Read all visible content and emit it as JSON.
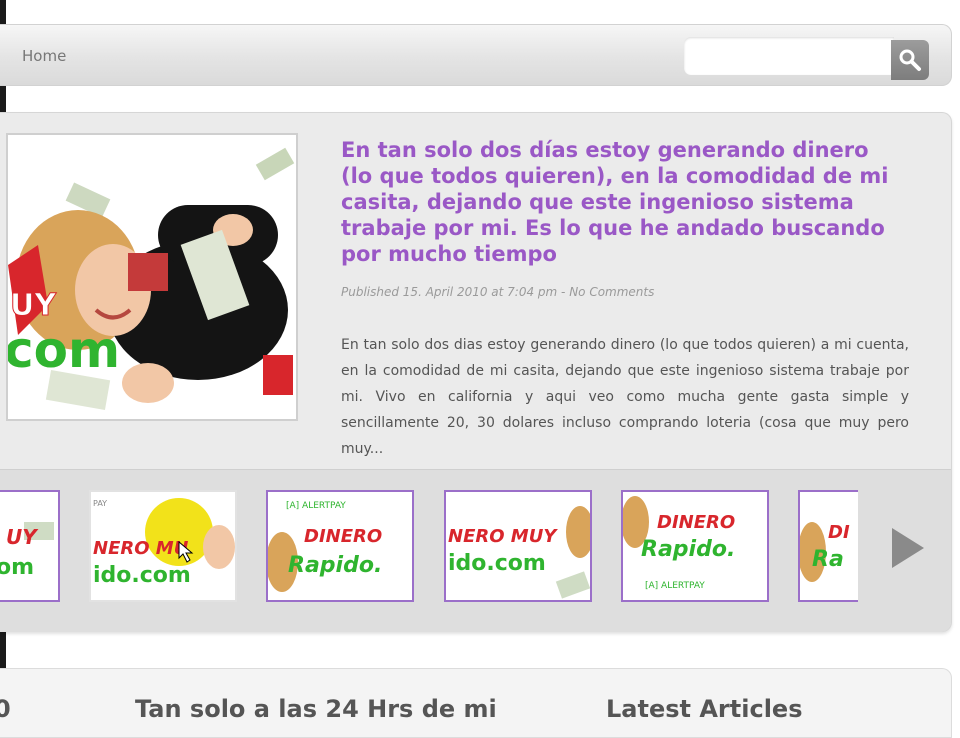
{
  "nav": {
    "home_label": "Home",
    "search_placeholder": ""
  },
  "featured": {
    "title": "En tan solo dos días estoy generando dinero (lo que todos quieren), en la comodidad de mi casita, dejando que este ingenioso sistema trabaje por mi. Es lo que he andado buscando por mucho tiempo",
    "meta": "Published 15. April 2010 at 7:04 pm - No Comments",
    "excerpt": "En tan solo dos dias estoy generando dinero (lo que todos quieren) a mi cuenta, en la comodidad de mi casita, dejando que este ingenioso sistema trabaje por mi. Vivo en california y aqui veo como mucha gente gasta simple y sencillamente 20, 30 dolares incluso comprando loteria (cosa que muy pero muy...",
    "image_text": {
      "line1": "UY",
      "line2": "com"
    }
  },
  "carousel": {
    "thumbs": [
      {
        "top": "UY",
        "bottom": "om",
        "badge": ""
      },
      {
        "top": "NERO MU",
        "bottom": "ido.com",
        "badge": "PAY"
      },
      {
        "top": "DINERO",
        "bottom": "Rapido.",
        "badge": "[A] ALERTPAY"
      },
      {
        "top": "NERO MUY",
        "bottom": "ido.com",
        "badge": ""
      },
      {
        "top": "DINERO",
        "bottom": "Rapido.",
        "badge": "[A] ALERTPAY"
      },
      {
        "top": "DI",
        "bottom": "Ra",
        "badge": ""
      }
    ]
  },
  "bottom": {
    "col1_heading": "0",
    "col2_heading": "Tan solo a las 24 Hrs de mi",
    "col3_heading": "Latest Articles"
  },
  "colors": {
    "title_purple": "#9a58c6",
    "thumb_border": "#9b6fc9",
    "brand_red": "#d8262c",
    "brand_green": "#2fb42f"
  },
  "icons": {
    "search": "magnifier-icon",
    "next": "play-arrow-icon"
  }
}
